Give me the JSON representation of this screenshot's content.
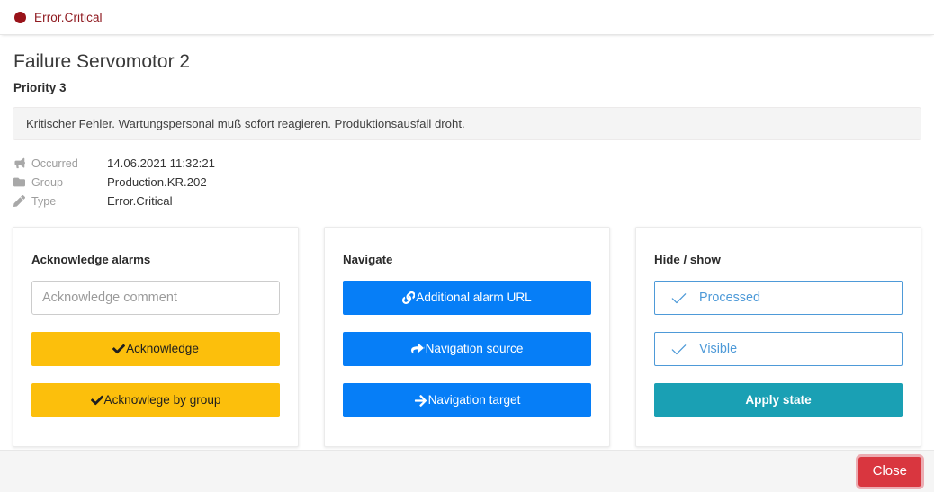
{
  "header": {
    "severity_icon": "circle-icon",
    "severity_label": "Error.Critical",
    "severity_color": "#99131a"
  },
  "alarm": {
    "title": "Failure Servomotor 2",
    "priority": "Priority 3",
    "message": "Kritischer Fehler. Wartungspersonal muß sofort reagieren. Produktionsausfall droht."
  },
  "meta": [
    {
      "icon": "bullhorn-icon",
      "key": "Occurred",
      "value": "14.06.2021 11:32:21"
    },
    {
      "icon": "folder-icon",
      "key": "Group",
      "value": "Production.KR.202"
    },
    {
      "icon": "pencil-icon",
      "key": "Type",
      "value": "Error.Critical"
    }
  ],
  "cards": {
    "acknowledge": {
      "title": "Acknowledge alarms",
      "comment_value": "",
      "comment_placeholder": "Acknowledge comment",
      "buttons": [
        {
          "icon": "check-icon",
          "label": "Acknowledge",
          "color": "#fcbf0c"
        },
        {
          "icon": "check-icon",
          "label": "Acknowlege by group",
          "color": "#fcbf0c"
        }
      ]
    },
    "navigate": {
      "title": "Navigate",
      "buttons": [
        {
          "icon": "link-icon",
          "label": "Additional alarm URL",
          "color": "#067ef7"
        },
        {
          "icon": "share-arrow-icon",
          "label": "Navigation source",
          "color": "#067ef7"
        },
        {
          "icon": "arrow-right-icon",
          "label": "Navigation target",
          "color": "#067ef7"
        }
      ]
    },
    "hideshow": {
      "title": "Hide / show",
      "toggles": [
        {
          "icon": "check-icon",
          "label": "Processed",
          "color": "#4e9ad8"
        },
        {
          "icon": "check-icon",
          "label": "Visible",
          "color": "#4e9ad8"
        }
      ],
      "apply_label": "Apply state",
      "apply_color": "#1aa0b4"
    }
  },
  "footer": {
    "close_label": "Close",
    "close_color": "#d9363f"
  }
}
